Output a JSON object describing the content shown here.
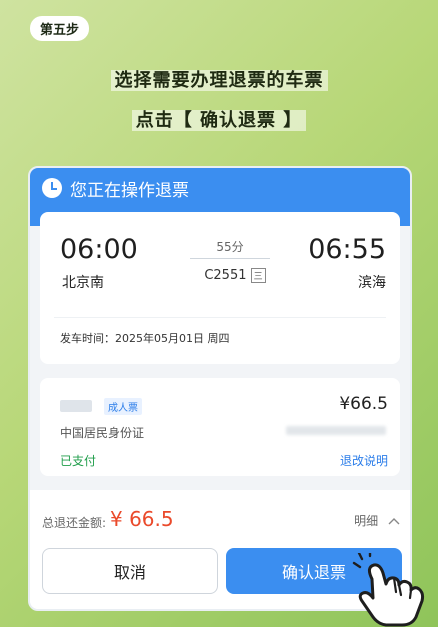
{
  "step_label": "第五步",
  "headline1": "选择需要办理退票的车票",
  "headline2": "点击【 确认退票 】",
  "panel": {
    "header_title": "您正在操作退票",
    "trip": {
      "dep_time": "06:00",
      "arr_time": "06:55",
      "dep_station": "北京南",
      "arr_station": "滨海",
      "duration": "55分",
      "train_no": "C2551",
      "train_badge": "三",
      "depart_text": "发车时间：2025年05月01日 周四"
    },
    "passenger": {
      "ticket_type": "成人票",
      "price": "¥66.5",
      "id_type": "中国居民身份证",
      "pay_status": "已支付",
      "rules_link": "退改说明"
    }
  },
  "footer": {
    "refund_label": "总退还金额:",
    "refund_amount": "¥ 66.5",
    "detail_label": "明细",
    "cancel_label": "取消",
    "confirm_label": "确认退票"
  },
  "colors": {
    "primary": "#3b8ef0",
    "refund": "#ea4a2b",
    "paid": "#1f9d4a"
  }
}
